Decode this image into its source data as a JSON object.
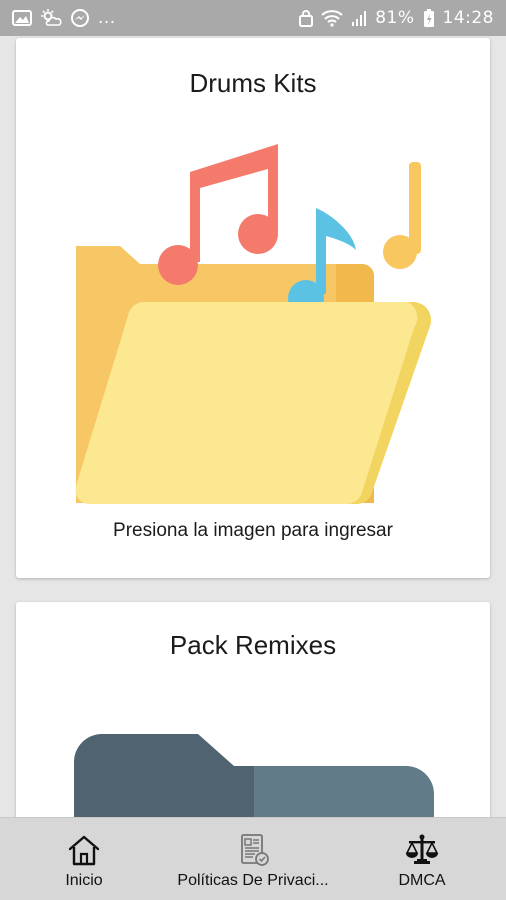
{
  "status_bar": {
    "left_icons": [
      "image-icon",
      "weather-icon",
      "messenger-icon"
    ],
    "more": "...",
    "battery_percent": "81%",
    "time": "14:28"
  },
  "cards": [
    {
      "title": "Drums Kits",
      "caption": "Presiona la imagen para ingresar",
      "image": "folder-music-icon"
    },
    {
      "title": "Pack Remixes",
      "image": "folder-dark-icon"
    }
  ],
  "bottom_nav": {
    "items": [
      {
        "label": "Inicio",
        "icon": "home-icon"
      },
      {
        "label": "Políticas De Privaci...",
        "icon": "privacy-document-icon"
      },
      {
        "label": "DMCA",
        "icon": "scales-icon"
      }
    ]
  },
  "colors": {
    "status_bar": "#a9a9a9",
    "background": "#e6e6e6",
    "folder_back": "#f7c766",
    "folder_front": "#fce891",
    "note_red": "#f47a6b",
    "note_blue": "#5bc2e3",
    "note_yellow": "#f8c75f",
    "folder_dark_back": "#4f6470",
    "folder_dark_front": "#617b88",
    "bottom_nav": "#d7d7d7"
  }
}
